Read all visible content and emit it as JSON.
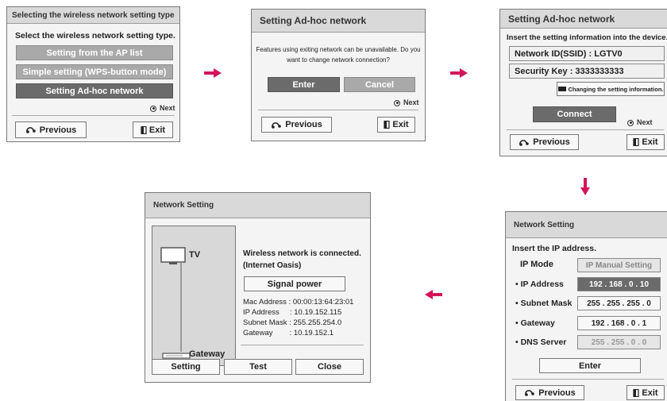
{
  "panel1": {
    "title": "Selecting the wireless network setting type",
    "prompt": "Select the wireless network setting type.",
    "options": [
      "Setting from the AP list",
      "Simple setting (WPS-button mode)",
      "Setting Ad-hoc network"
    ],
    "next": "Next",
    "previous": "Previous",
    "exit": "Exit"
  },
  "panel2": {
    "title": "Setting Ad-hoc network",
    "message_line1": "Features using exiting network can be unavailable. Do you",
    "message_line2": "want to change network connection?",
    "enter": "Enter",
    "cancel": "Cancel",
    "next": "Next",
    "previous": "Previous",
    "exit": "Exit"
  },
  "panel3": {
    "title": "Setting Ad-hoc network",
    "prompt": "Insert the setting information into the device.",
    "network_id": "Network ID(SSID) : LGTV0",
    "security_key": "Security Key : 3333333333",
    "changing": "Changing the setting information.",
    "connect": "Connect",
    "next": "Next",
    "previous": "Previous",
    "exit": "Exit"
  },
  "panel4": {
    "title": "Network Setting",
    "prompt": "Insert the IP address.",
    "ip_mode_label": "IP Mode",
    "ip_mode_value": "IP Manual Setting",
    "fields": [
      {
        "label": "• IP Address",
        "value": "192 . 168 . 0 . 10"
      },
      {
        "label": "• Subnet Mask",
        "value": "255 . 255 . 255 . 0"
      },
      {
        "label": "• Gateway",
        "value": "192 . 168 . 0 . 1"
      },
      {
        "label": "• DNS Server",
        "value": "255 . 255 . 0 . 0"
      }
    ],
    "enter": "Enter",
    "previous": "Previous",
    "exit": "Exit"
  },
  "panel5": {
    "title": "Network Setting",
    "tv_label": "TV",
    "gateway_label": "Gateway",
    "status_line1": "Wireless network is connected.",
    "status_line2": "(Internet Oasis)",
    "signal_power": "Signal power",
    "info": [
      "Mac Address : 00:00:13:64:23:01",
      "IP Address     : 10.19.152.115",
      "Subnet Mask : 255.255.254.0",
      "Gateway        : 10.19.152.1"
    ],
    "setting": "Setting",
    "test": "Test",
    "close": "Close"
  },
  "colors": {
    "arrow": "#d4145a",
    "selected": "#6b6b6b",
    "disabled": "#a9a9a9"
  },
  "icons": {
    "previous": "previous-return-icon",
    "exit": "exit-door-icon",
    "next": "next-ok-icon"
  }
}
